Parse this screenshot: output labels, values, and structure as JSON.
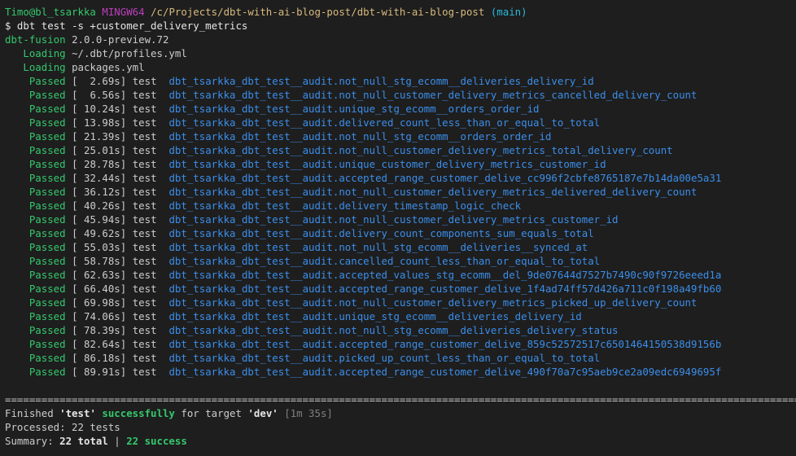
{
  "prompt": {
    "user_host": "Timo@bl_tsarkka",
    "shell": "MINGW64",
    "path": "/c/Projects/dbt-with-ai-blog-post/dbt-with-ai-blog-post",
    "branch": "(main)",
    "command": "$ dbt test -s +customer_delivery_metrics"
  },
  "header": {
    "product": "dbt-fusion",
    "version": "2.0.0-preview.72",
    "loading": [
      {
        "label": "Loading",
        "value": "~/.dbt/profiles.yml"
      },
      {
        "label": "Loading",
        "value": "packages.yml"
      }
    ]
  },
  "results": [
    {
      "status": "Passed",
      "time": "[  2.69s]",
      "kind": "test",
      "schema": "dbt_tsarkka_dbt_test__audit",
      "name": "not_null_stg_ecomm__deliveries_delivery_id"
    },
    {
      "status": "Passed",
      "time": "[  6.56s]",
      "kind": "test",
      "schema": "dbt_tsarkka_dbt_test__audit",
      "name": "not_null_customer_delivery_metrics_cancelled_delivery_count"
    },
    {
      "status": "Passed",
      "time": "[ 10.24s]",
      "kind": "test",
      "schema": "dbt_tsarkka_dbt_test__audit",
      "name": "unique_stg_ecomm__orders_order_id"
    },
    {
      "status": "Passed",
      "time": "[ 13.98s]",
      "kind": "test",
      "schema": "dbt_tsarkka_dbt_test__audit",
      "name": "delivered_count_less_than_or_equal_to_total"
    },
    {
      "status": "Passed",
      "time": "[ 21.39s]",
      "kind": "test",
      "schema": "dbt_tsarkka_dbt_test__audit",
      "name": "not_null_stg_ecomm__orders_order_id"
    },
    {
      "status": "Passed",
      "time": "[ 25.01s]",
      "kind": "test",
      "schema": "dbt_tsarkka_dbt_test__audit",
      "name": "not_null_customer_delivery_metrics_total_delivery_count"
    },
    {
      "status": "Passed",
      "time": "[ 28.78s]",
      "kind": "test",
      "schema": "dbt_tsarkka_dbt_test__audit",
      "name": "unique_customer_delivery_metrics_customer_id"
    },
    {
      "status": "Passed",
      "time": "[ 32.44s]",
      "kind": "test",
      "schema": "dbt_tsarkka_dbt_test__audit",
      "name": "accepted_range_customer_delive_cc996f2cbfe8765187e7b14da00e5a31"
    },
    {
      "status": "Passed",
      "time": "[ 36.12s]",
      "kind": "test",
      "schema": "dbt_tsarkka_dbt_test__audit",
      "name": "not_null_customer_delivery_metrics_delivered_delivery_count"
    },
    {
      "status": "Passed",
      "time": "[ 40.26s]",
      "kind": "test",
      "schema": "dbt_tsarkka_dbt_test__audit",
      "name": "delivery_timestamp_logic_check"
    },
    {
      "status": "Passed",
      "time": "[ 45.94s]",
      "kind": "test",
      "schema": "dbt_tsarkka_dbt_test__audit",
      "name": "not_null_customer_delivery_metrics_customer_id"
    },
    {
      "status": "Passed",
      "time": "[ 49.62s]",
      "kind": "test",
      "schema": "dbt_tsarkka_dbt_test__audit",
      "name": "delivery_count_components_sum_equals_total"
    },
    {
      "status": "Passed",
      "time": "[ 55.03s]",
      "kind": "test",
      "schema": "dbt_tsarkka_dbt_test__audit",
      "name": "not_null_stg_ecomm__deliveries__synced_at"
    },
    {
      "status": "Passed",
      "time": "[ 58.78s]",
      "kind": "test",
      "schema": "dbt_tsarkka_dbt_test__audit",
      "name": "cancelled_count_less_than_or_equal_to_total"
    },
    {
      "status": "Passed",
      "time": "[ 62.63s]",
      "kind": "test",
      "schema": "dbt_tsarkka_dbt_test__audit",
      "name": "accepted_values_stg_ecomm__del_9de07644d7527b7490c90f9726eeed1a"
    },
    {
      "status": "Passed",
      "time": "[ 66.40s]",
      "kind": "test",
      "schema": "dbt_tsarkka_dbt_test__audit",
      "name": "accepted_range_customer_delive_1f4ad74ff57d426a711c0f198a49fb60"
    },
    {
      "status": "Passed",
      "time": "[ 69.98s]",
      "kind": "test",
      "schema": "dbt_tsarkka_dbt_test__audit",
      "name": "not_null_customer_delivery_metrics_picked_up_delivery_count"
    },
    {
      "status": "Passed",
      "time": "[ 74.06s]",
      "kind": "test",
      "schema": "dbt_tsarkka_dbt_test__audit",
      "name": "unique_stg_ecomm__deliveries_delivery_id"
    },
    {
      "status": "Passed",
      "time": "[ 78.39s]",
      "kind": "test",
      "schema": "dbt_tsarkka_dbt_test__audit",
      "name": "not_null_stg_ecomm__deliveries_delivery_status"
    },
    {
      "status": "Passed",
      "time": "[ 82.64s]",
      "kind": "test",
      "schema": "dbt_tsarkka_dbt_test__audit",
      "name": "accepted_range_customer_delive_859c52572517c6501464150538d9156b"
    },
    {
      "status": "Passed",
      "time": "[ 86.18s]",
      "kind": "test",
      "schema": "dbt_tsarkka_dbt_test__audit",
      "name": "picked_up_count_less_than_or_equal_to_total"
    },
    {
      "status": "Passed",
      "time": "[ 89.91s]",
      "kind": "test",
      "schema": "dbt_tsarkka_dbt_test__audit",
      "name": "accepted_range_customer_delive_490f70a7c95aeb9ce2a09edc6949695f"
    }
  ],
  "summary": {
    "ruler": "====================================================================================================================================",
    "finished_prefix": "Finished ",
    "command_quoted": "'test'",
    "successfully": "successfully",
    "for_target": " for target ",
    "target_quoted": "'dev'",
    "duration": "[1m 35s]",
    "processed": "Processed: 22 tests",
    "summary_label": "Summary: ",
    "total": "22 total",
    "separator": " | ",
    "success": "22 success"
  },
  "colors": {
    "background": "#1e1e1e",
    "text": "#cccccc",
    "green": "#35c86d",
    "magenta": "#bc3fbc",
    "yellow": "#d7ba7d",
    "cyan": "#29b8db",
    "blue": "#3b8eea",
    "dim": "#808080"
  }
}
